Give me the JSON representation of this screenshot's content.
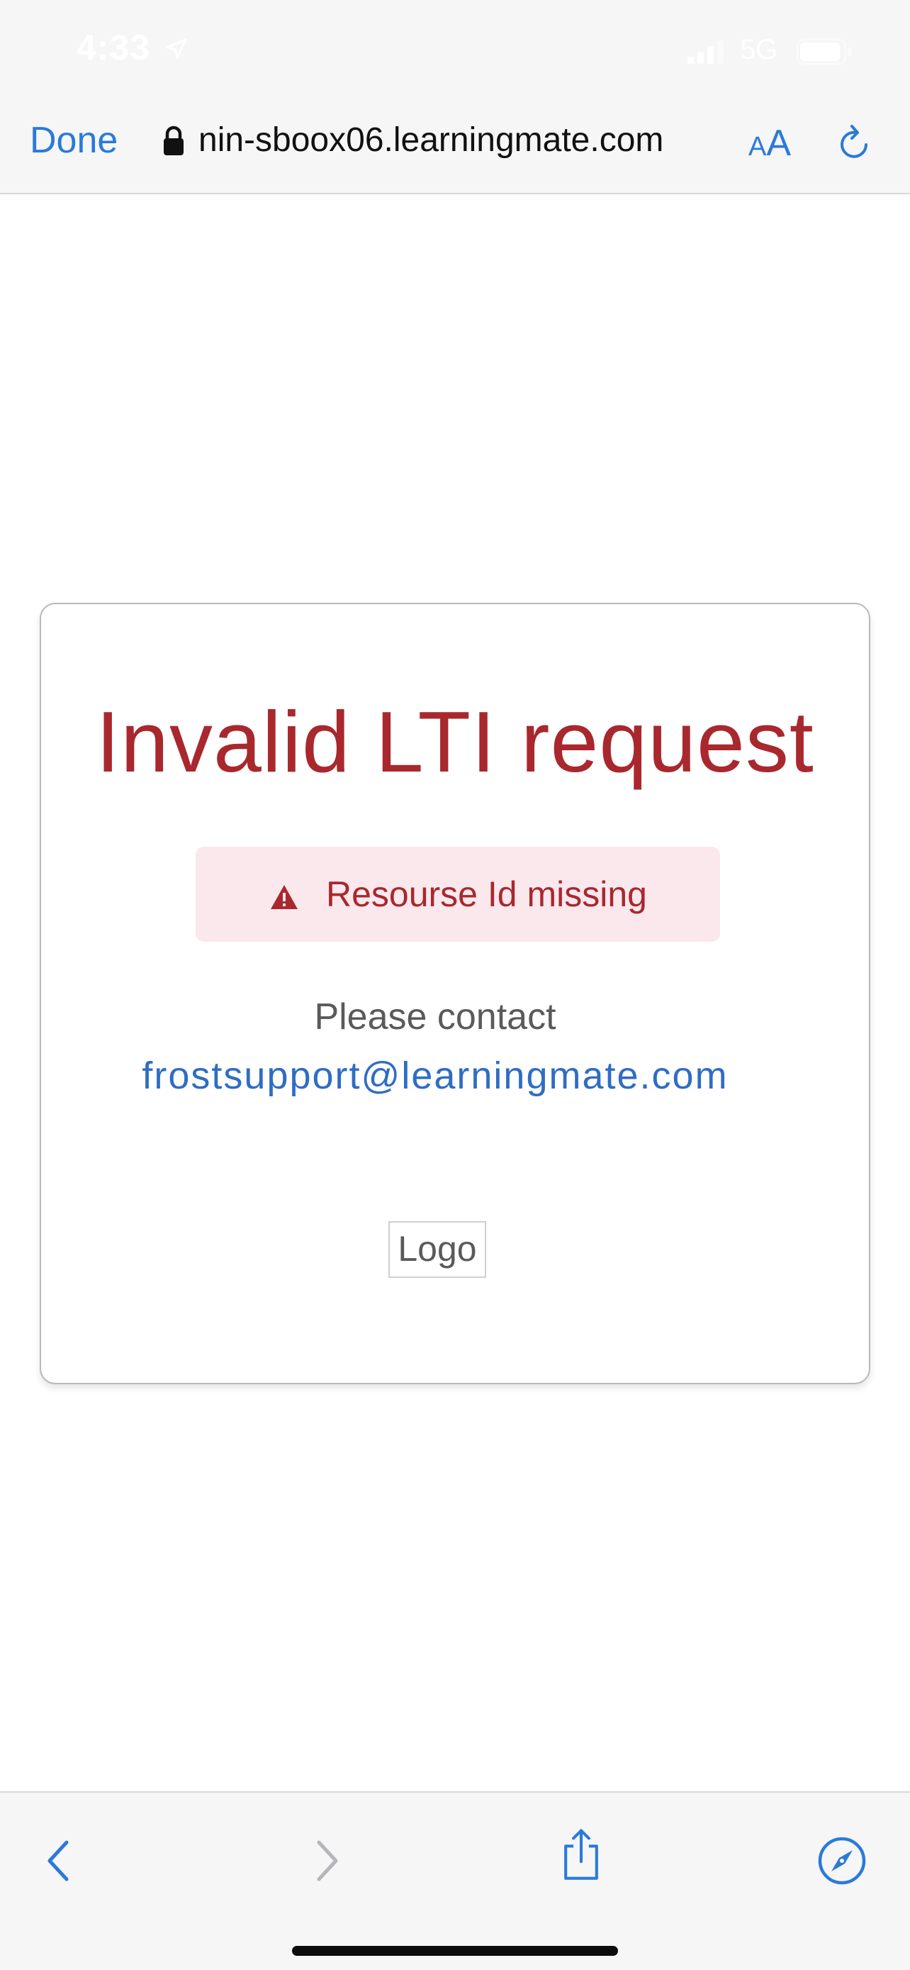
{
  "status_bar": {
    "time": "4:33",
    "network": "5G",
    "icons": [
      "location-arrow-icon",
      "signal-bars-icon",
      "battery-icon"
    ]
  },
  "safari": {
    "done_label": "Done",
    "url": "nin-sboox06.learningmate.com",
    "aa_small": "A",
    "aa_big": "A",
    "icons": [
      "lock-icon",
      "reload-icon"
    ],
    "accent_color": "#2a7ad9"
  },
  "page": {
    "title": "Invalid LTI request",
    "alert": {
      "message": "Resourse Id missing",
      "icon": "warning-triangle-icon",
      "background_color": "#fae8ed",
      "text_color": "#a8282e"
    },
    "contact_prefix": "Please contact",
    "contact_email": "frostsupport@learningmate.com",
    "logo_alt": "Logo"
  },
  "toolbar": {
    "icons": [
      "back-chevron-icon",
      "forward-chevron-icon",
      "share-icon",
      "compass-icon"
    ],
    "forward_enabled": false
  }
}
